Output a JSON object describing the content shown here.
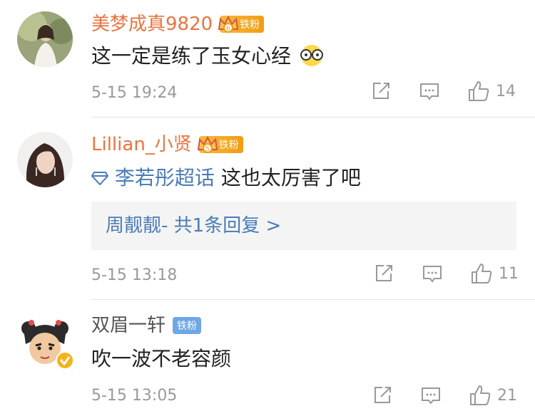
{
  "comments": [
    {
      "username": "美梦成真9820",
      "badge": "铁粉",
      "text": "这一定是练了玉女心经",
      "time": "5-15 19:24",
      "likes": "14"
    },
    {
      "username": "Lillian_小贤",
      "badge": "铁粉",
      "topic": "李若彤超话",
      "text": " 这也太厉害了吧",
      "reply_summary": "周靓靓- 共1条回复 >",
      "time": "5-15 13:18",
      "likes": "11"
    },
    {
      "username": "双眉一轩",
      "badge": "铁粉",
      "text": "吹一波不老容颜",
      "time": "5-15 13:05",
      "likes": "21"
    }
  ],
  "colors": {
    "vip_name": "#eb7340",
    "link": "#4a7bb7",
    "meta": "#999999"
  },
  "icons": [
    "crown-icon",
    "emoji-glasses-icon",
    "diamond-icon",
    "forward-icon",
    "comment-icon",
    "like-icon",
    "verified-icon"
  ]
}
